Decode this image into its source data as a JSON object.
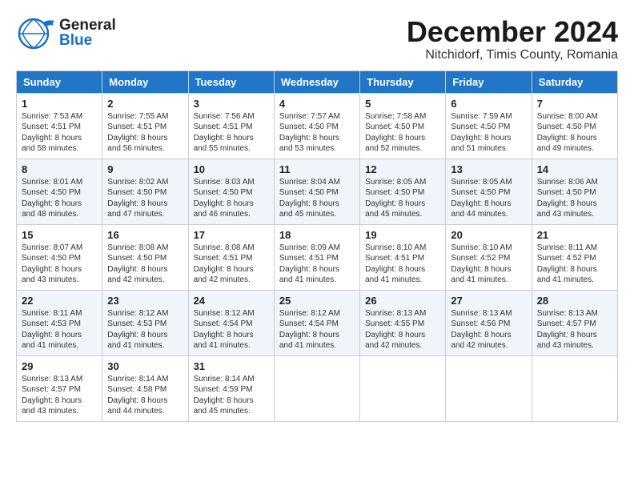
{
  "header": {
    "logo_general": "General",
    "logo_blue": "Blue",
    "title": "December 2024",
    "subtitle": "Nitchidorf, Timis County, Romania"
  },
  "days_of_week": [
    "Sunday",
    "Monday",
    "Tuesday",
    "Wednesday",
    "Thursday",
    "Friday",
    "Saturday"
  ],
  "weeks": [
    [
      {
        "day": "1",
        "sunrise": "Sunrise: 7:53 AM",
        "sunset": "Sunset: 4:51 PM",
        "daylight": "Daylight: 8 hours and 58 minutes."
      },
      {
        "day": "2",
        "sunrise": "Sunrise: 7:55 AM",
        "sunset": "Sunset: 4:51 PM",
        "daylight": "Daylight: 8 hours and 56 minutes."
      },
      {
        "day": "3",
        "sunrise": "Sunrise: 7:56 AM",
        "sunset": "Sunset: 4:51 PM",
        "daylight": "Daylight: 8 hours and 55 minutes."
      },
      {
        "day": "4",
        "sunrise": "Sunrise: 7:57 AM",
        "sunset": "Sunset: 4:50 PM",
        "daylight": "Daylight: 8 hours and 53 minutes."
      },
      {
        "day": "5",
        "sunrise": "Sunrise: 7:58 AM",
        "sunset": "Sunset: 4:50 PM",
        "daylight": "Daylight: 8 hours and 52 minutes."
      },
      {
        "day": "6",
        "sunrise": "Sunrise: 7:59 AM",
        "sunset": "Sunset: 4:50 PM",
        "daylight": "Daylight: 8 hours and 51 minutes."
      },
      {
        "day": "7",
        "sunrise": "Sunrise: 8:00 AM",
        "sunset": "Sunset: 4:50 PM",
        "daylight": "Daylight: 8 hours and 49 minutes."
      }
    ],
    [
      {
        "day": "8",
        "sunrise": "Sunrise: 8:01 AM",
        "sunset": "Sunset: 4:50 PM",
        "daylight": "Daylight: 8 hours and 48 minutes."
      },
      {
        "day": "9",
        "sunrise": "Sunrise: 8:02 AM",
        "sunset": "Sunset: 4:50 PM",
        "daylight": "Daylight: 8 hours and 47 minutes."
      },
      {
        "day": "10",
        "sunrise": "Sunrise: 8:03 AM",
        "sunset": "Sunset: 4:50 PM",
        "daylight": "Daylight: 8 hours and 46 minutes."
      },
      {
        "day": "11",
        "sunrise": "Sunrise: 8:04 AM",
        "sunset": "Sunset: 4:50 PM",
        "daylight": "Daylight: 8 hours and 45 minutes."
      },
      {
        "day": "12",
        "sunrise": "Sunrise: 8:05 AM",
        "sunset": "Sunset: 4:50 PM",
        "daylight": "Daylight: 8 hours and 45 minutes."
      },
      {
        "day": "13",
        "sunrise": "Sunrise: 8:05 AM",
        "sunset": "Sunset: 4:50 PM",
        "daylight": "Daylight: 8 hours and 44 minutes."
      },
      {
        "day": "14",
        "sunrise": "Sunrise: 8:06 AM",
        "sunset": "Sunset: 4:50 PM",
        "daylight": "Daylight: 8 hours and 43 minutes."
      }
    ],
    [
      {
        "day": "15",
        "sunrise": "Sunrise: 8:07 AM",
        "sunset": "Sunset: 4:50 PM",
        "daylight": "Daylight: 8 hours and 43 minutes."
      },
      {
        "day": "16",
        "sunrise": "Sunrise: 8:08 AM",
        "sunset": "Sunset: 4:50 PM",
        "daylight": "Daylight: 8 hours and 42 minutes."
      },
      {
        "day": "17",
        "sunrise": "Sunrise: 8:08 AM",
        "sunset": "Sunset: 4:51 PM",
        "daylight": "Daylight: 8 hours and 42 minutes."
      },
      {
        "day": "18",
        "sunrise": "Sunrise: 8:09 AM",
        "sunset": "Sunset: 4:51 PM",
        "daylight": "Daylight: 8 hours and 41 minutes."
      },
      {
        "day": "19",
        "sunrise": "Sunrise: 8:10 AM",
        "sunset": "Sunset: 4:51 PM",
        "daylight": "Daylight: 8 hours and 41 minutes."
      },
      {
        "day": "20",
        "sunrise": "Sunrise: 8:10 AM",
        "sunset": "Sunset: 4:52 PM",
        "daylight": "Daylight: 8 hours and 41 minutes."
      },
      {
        "day": "21",
        "sunrise": "Sunrise: 8:11 AM",
        "sunset": "Sunset: 4:52 PM",
        "daylight": "Daylight: 8 hours and 41 minutes."
      }
    ],
    [
      {
        "day": "22",
        "sunrise": "Sunrise: 8:11 AM",
        "sunset": "Sunset: 4:53 PM",
        "daylight": "Daylight: 8 hours and 41 minutes."
      },
      {
        "day": "23",
        "sunrise": "Sunrise: 8:12 AM",
        "sunset": "Sunset: 4:53 PM",
        "daylight": "Daylight: 8 hours and 41 minutes."
      },
      {
        "day": "24",
        "sunrise": "Sunrise: 8:12 AM",
        "sunset": "Sunset: 4:54 PM",
        "daylight": "Daylight: 8 hours and 41 minutes."
      },
      {
        "day": "25",
        "sunrise": "Sunrise: 8:12 AM",
        "sunset": "Sunset: 4:54 PM",
        "daylight": "Daylight: 8 hours and 41 minutes."
      },
      {
        "day": "26",
        "sunrise": "Sunrise: 8:13 AM",
        "sunset": "Sunset: 4:55 PM",
        "daylight": "Daylight: 8 hours and 42 minutes."
      },
      {
        "day": "27",
        "sunrise": "Sunrise: 8:13 AM",
        "sunset": "Sunset: 4:56 PM",
        "daylight": "Daylight: 8 hours and 42 minutes."
      },
      {
        "day": "28",
        "sunrise": "Sunrise: 8:13 AM",
        "sunset": "Sunset: 4:57 PM",
        "daylight": "Daylight: 8 hours and 43 minutes."
      }
    ],
    [
      {
        "day": "29",
        "sunrise": "Sunrise: 8:13 AM",
        "sunset": "Sunset: 4:57 PM",
        "daylight": "Daylight: 8 hours and 43 minutes."
      },
      {
        "day": "30",
        "sunrise": "Sunrise: 8:14 AM",
        "sunset": "Sunset: 4:58 PM",
        "daylight": "Daylight: 8 hours and 44 minutes."
      },
      {
        "day": "31",
        "sunrise": "Sunrise: 8:14 AM",
        "sunset": "Sunset: 4:59 PM",
        "daylight": "Daylight: 8 hours and 45 minutes."
      },
      null,
      null,
      null,
      null
    ]
  ]
}
